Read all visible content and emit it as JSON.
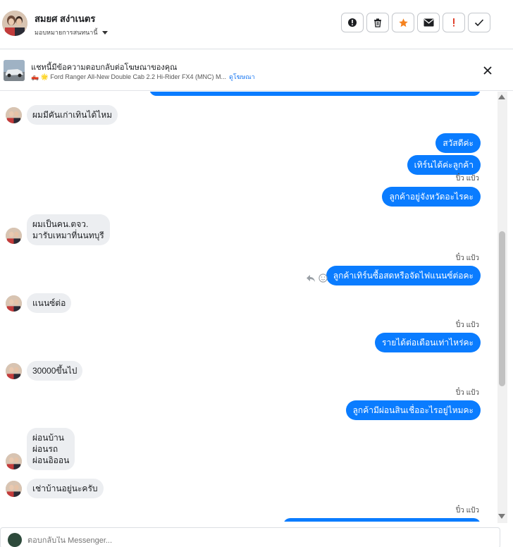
{
  "header": {
    "contact_name": "สมยศ สง่าเนตร",
    "assign_label": "มอบหมายการสนทนานี้",
    "icons": [
      "exclamation-circle-icon",
      "trash-icon",
      "star-icon",
      "envelope-icon",
      "exclamation-icon",
      "check-icon"
    ]
  },
  "ad": {
    "title": "แชทนี้มีข้อความตอบกลับต่อโฆษณาของคุณ",
    "subtitle": "🛻 🌟 Ford Ranger All-New Double Cab 2.2 Hi-Rider FX4 (MNC) M...",
    "link": "ดูโฆษณา"
  },
  "messages": [
    {
      "dir": "in",
      "text": "ผมมีคันเก่าเทินได้ไหม"
    },
    {
      "dir": "out",
      "text": "สวัสดีค่ะ"
    },
    {
      "dir": "out",
      "text": "เทิร์นได้ค่ะลูกค้า"
    },
    {
      "dir": "sender",
      "text": "ปิ๋ว แป้ว"
    },
    {
      "dir": "out",
      "text": "ลูกค้าอยู่จังหวัดอะไรคะ"
    },
    {
      "dir": "in",
      "text": "ผมเป็นคน.ตจว.\nมารับเหมาที่นนทบุรี"
    },
    {
      "dir": "sender",
      "text": "ปิ๋ว แป้ว"
    },
    {
      "dir": "out",
      "text": "ลูกค้าเทิร์นซื้อสดหรือจัดไฟแนนซ์ต่อคะ"
    },
    {
      "dir": "in",
      "text": "แนนซ์ต่อ"
    },
    {
      "dir": "sender",
      "text": "ปิ๋ว แป้ว"
    },
    {
      "dir": "out",
      "text": "รายได้ต่อเดือนเท่าไหร่คะ"
    },
    {
      "dir": "in",
      "text": "30000ขึ้นไป"
    },
    {
      "dir": "sender",
      "text": "ปิ๋ว แป้ว"
    },
    {
      "dir": "out",
      "text": "ลูกค้ามีผ่อนสินเชื่ออะไรอยู่ไหมคะ"
    },
    {
      "dir": "in",
      "text": "ผ่อนบ้าน\nผ่อนรถ\nผ่อนอิออน"
    },
    {
      "dir": "in",
      "text": "เช่าบ้านอยู่นะครับ"
    },
    {
      "dir": "sender",
      "text": "ปิ๋ว แป้ว"
    }
  ],
  "composer": {
    "placeholder": "ตอบกลับใน Messenger..."
  },
  "colors": {
    "outgoing_bubble": "#0a7cff",
    "incoming_bubble": "#eceef1",
    "star_accent": "#f5821f",
    "alert_accent": "#e0412c"
  }
}
